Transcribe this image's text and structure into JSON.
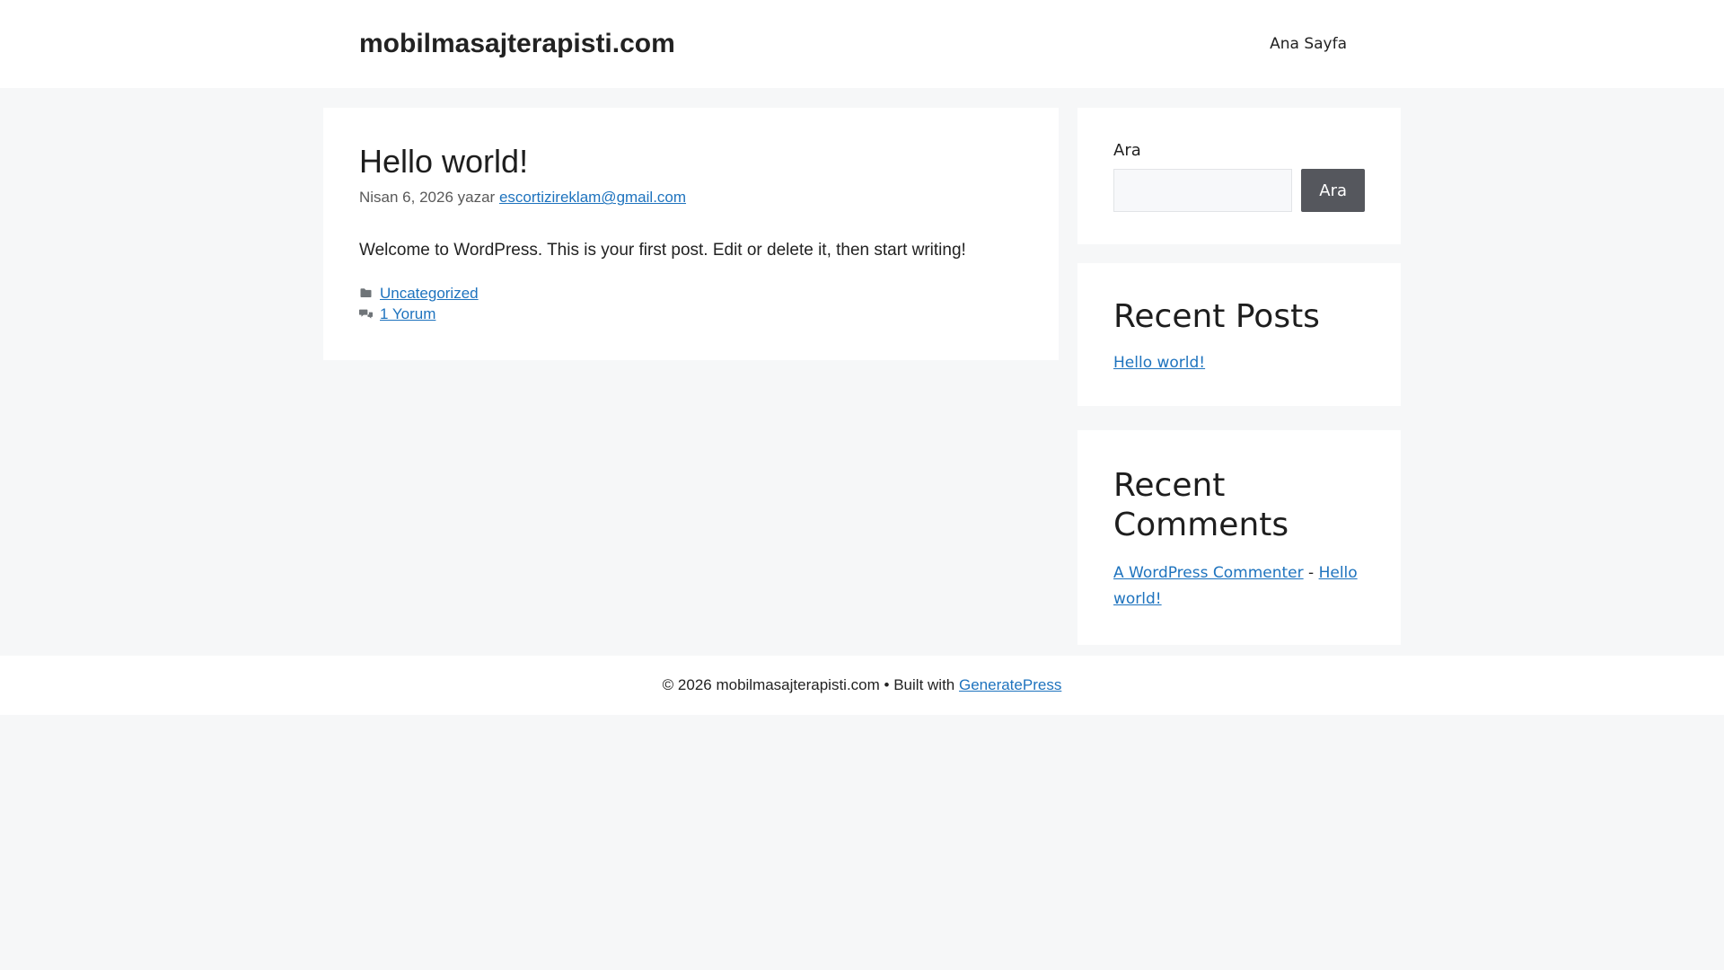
{
  "site": {
    "title": "mobilmasajterapisti.com"
  },
  "nav": {
    "items": [
      {
        "label": "Ana Sayfa"
      }
    ]
  },
  "post": {
    "title": "Hello world!",
    "meta": {
      "date": "Nisan 6, 2026",
      "by_label": "yazar",
      "author": "escortizireklam@gmail.com"
    },
    "content": "Welcome to WordPress. This is your first post. Edit or delete it, then start writing!",
    "category": "Uncategorized",
    "comments_link": "1 Yorum"
  },
  "sidebar": {
    "search": {
      "label": "Ara",
      "button": "Ara",
      "value": "",
      "placeholder": ""
    },
    "recent_posts": {
      "title": "Recent Posts",
      "items": [
        "Hello world!"
      ]
    },
    "recent_comments": {
      "title": "Recent Comments",
      "items": [
        {
          "author": "A WordPress Commenter",
          "separator": " - ",
          "post": "Hello world!"
        }
      ]
    }
  },
  "footer": {
    "copyright": "© 2026 mobilmasajterapisti.com",
    "separator": "•",
    "built_with": "Built with",
    "builder_link": "GeneratePress"
  },
  "colors": {
    "page_bg": "#f6f7f8",
    "card_bg": "#ffffff",
    "link": "#1e73be",
    "button_bg": "#55575d",
    "button_text": "#ffffff",
    "heading_text": "#1e1e1e",
    "body_text": "#222222",
    "meta_text": "#595959",
    "icon_gray": "#6f7478"
  },
  "icons": {
    "category": "folder-icon",
    "comments": "speech-bubbles-icon"
  }
}
